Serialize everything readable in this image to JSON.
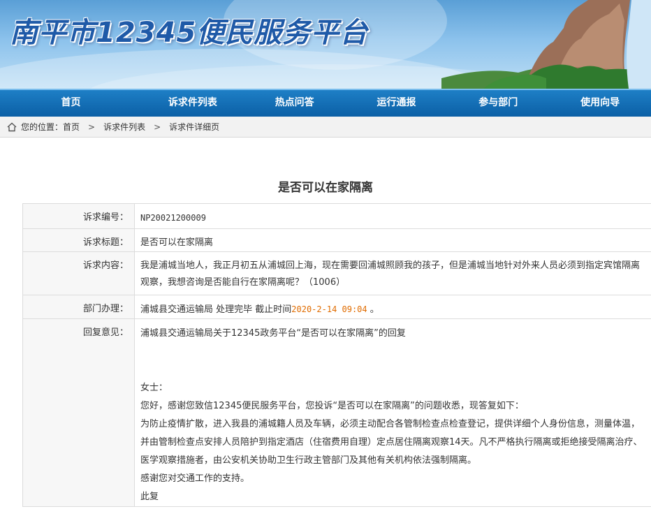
{
  "banner": {
    "title": "南平市12345便民服务平台"
  },
  "nav": {
    "items": [
      "首页",
      "诉求件列表",
      "热点问答",
      "运行通报",
      "参与部门",
      "使用向导"
    ]
  },
  "breadcrumb": {
    "prefix": "您的位置：",
    "items": [
      "首页",
      "诉求件列表",
      "诉求件详细页"
    ],
    "separator": ">"
  },
  "detail": {
    "title": "是否可以在家隔离",
    "rows": {
      "code_label": "诉求编号：",
      "code_value": "NP20021200009",
      "subject_label": "诉求标题：",
      "subject_value": "是否可以在家隔离",
      "content_label": "诉求内容：",
      "content_value": "我是浦城当地人，我正月初五从浦城回上海，现在需要回浦城照顾我的孩子，但是浦城当地针对外来人员必须到指定宾馆隔离观察，我想咨询是否能自行在家隔离呢？（1006）",
      "dept_label": "部门办理：",
      "dept_value": "浦城县交通运输局 处理完毕 截止时间",
      "dept_deadline": "2020-2-14 09:04",
      "dept_end": "。",
      "reply_label": "回复意见：",
      "reply_heading": "浦城县交通运输局关于12345政务平台“是否可以在家隔离”的回复",
      "reply_greeting": "女士：",
      "reply_p1": "您好，感谢您致信12345便民服务平台，您投诉“是否可以在家隔离”的问题收悉，现答复如下：",
      "reply_p2": "为防止疫情扩散，进入我县的浦城籍人员及车辆，必须主动配合各管制检查点检查登记，提供详细个人身份信息，测量体温，并由管制检查点安排人员陪护到指定酒店（住宿费用自理）定点居住隔离观察14天。凡不严格执行隔离或拒绝接受隔离治疗、医学观察措施者，由公安机关协助卫生行政主管部门及其他有关机构依法强制隔离。",
      "reply_p3": "感谢您对交通工作的支持。",
      "reply_p4": "此复"
    }
  },
  "colors": {
    "nav_bg": "#0b5fa5",
    "title_blue": "#1f5aa8",
    "deadline_orange": "#e06c00"
  }
}
